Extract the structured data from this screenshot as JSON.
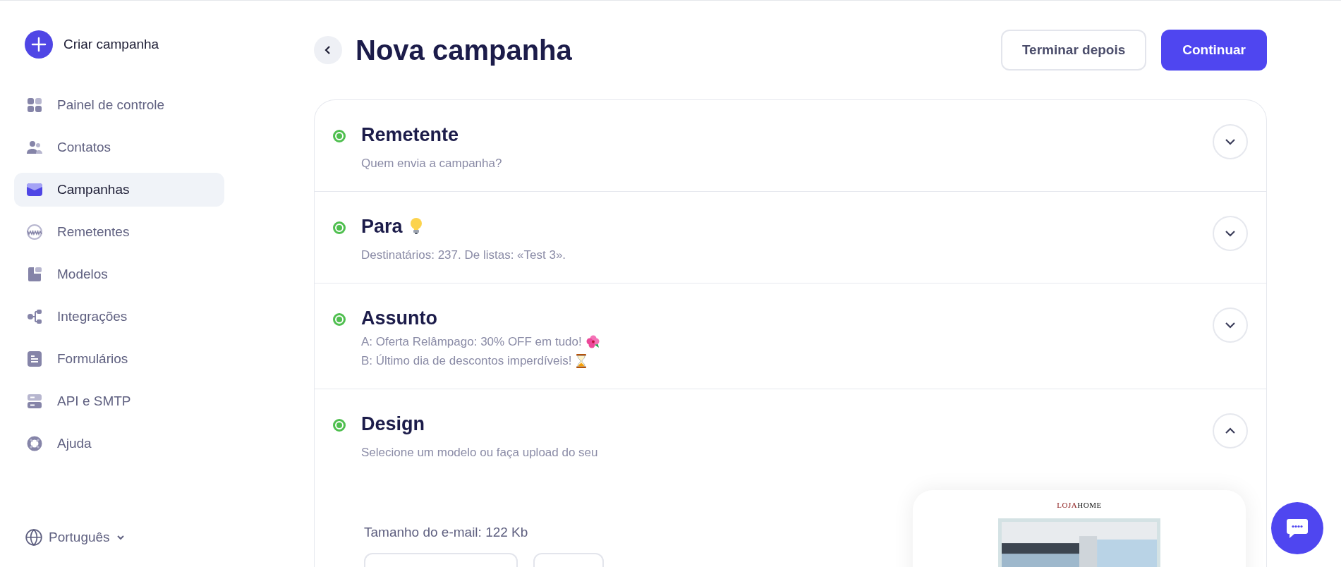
{
  "sidebar": {
    "create_button": "Criar campanha",
    "items": [
      {
        "label": "Painel de controle",
        "kind": "grid",
        "selected": false
      },
      {
        "label": "Contatos",
        "kind": "people",
        "selected": false
      },
      {
        "label": "Campanhas",
        "kind": "mail",
        "selected": true
      },
      {
        "label": "Remetentes",
        "kind": "www",
        "selected": false
      },
      {
        "label": "Modelos",
        "kind": "template",
        "selected": false
      },
      {
        "label": "Integrações",
        "kind": "nodes",
        "selected": false
      },
      {
        "label": "Formulários",
        "kind": "form",
        "selected": false
      },
      {
        "label": "API e SMTP",
        "kind": "server",
        "selected": false
      },
      {
        "label": "Ajuda",
        "kind": "ring",
        "selected": false
      }
    ],
    "language": "Português"
  },
  "header": {
    "title": "Nova campanha",
    "buttons": [
      {
        "label": "Terminar depois",
        "kind": "secondary"
      },
      {
        "label": "Continuar",
        "kind": "primary"
      }
    ]
  },
  "sections": [
    {
      "title": "Remetente",
      "kind": "plain",
      "done": true,
      "expanded": false,
      "lines": [
        {
          "text": "Quem envia a campanha?",
          "kind": "plain"
        }
      ]
    },
    {
      "title": "Para",
      "kind": "bulb",
      "done": true,
      "expanded": false,
      "lines": [
        {
          "text": "Destinatários: 237. De listas: «Test 3».",
          "kind": "plain"
        }
      ]
    },
    {
      "title": "Assunto",
      "kind": "plain",
      "done": true,
      "expanded": false,
      "lines": [
        {
          "text": "A: Oferta Relâmpago: 30% OFF em tudo!",
          "kind": "flower"
        },
        {
          "text": "B: Último dia de descontos imperdíveis!",
          "kind": "hourglass"
        }
      ]
    },
    {
      "title": "Design",
      "kind": "plain",
      "done": true,
      "expanded": true,
      "lines": [
        {
          "text": "Selecione um modelo ou faça upload do seu",
          "kind": "plain"
        }
      ],
      "email_size": "Tamanho do e-mail: 122 Kb",
      "preview": {
        "logo_a": "LOJA",
        "logo_b": "HOME",
        "kind": "picture"
      }
    }
  ]
}
